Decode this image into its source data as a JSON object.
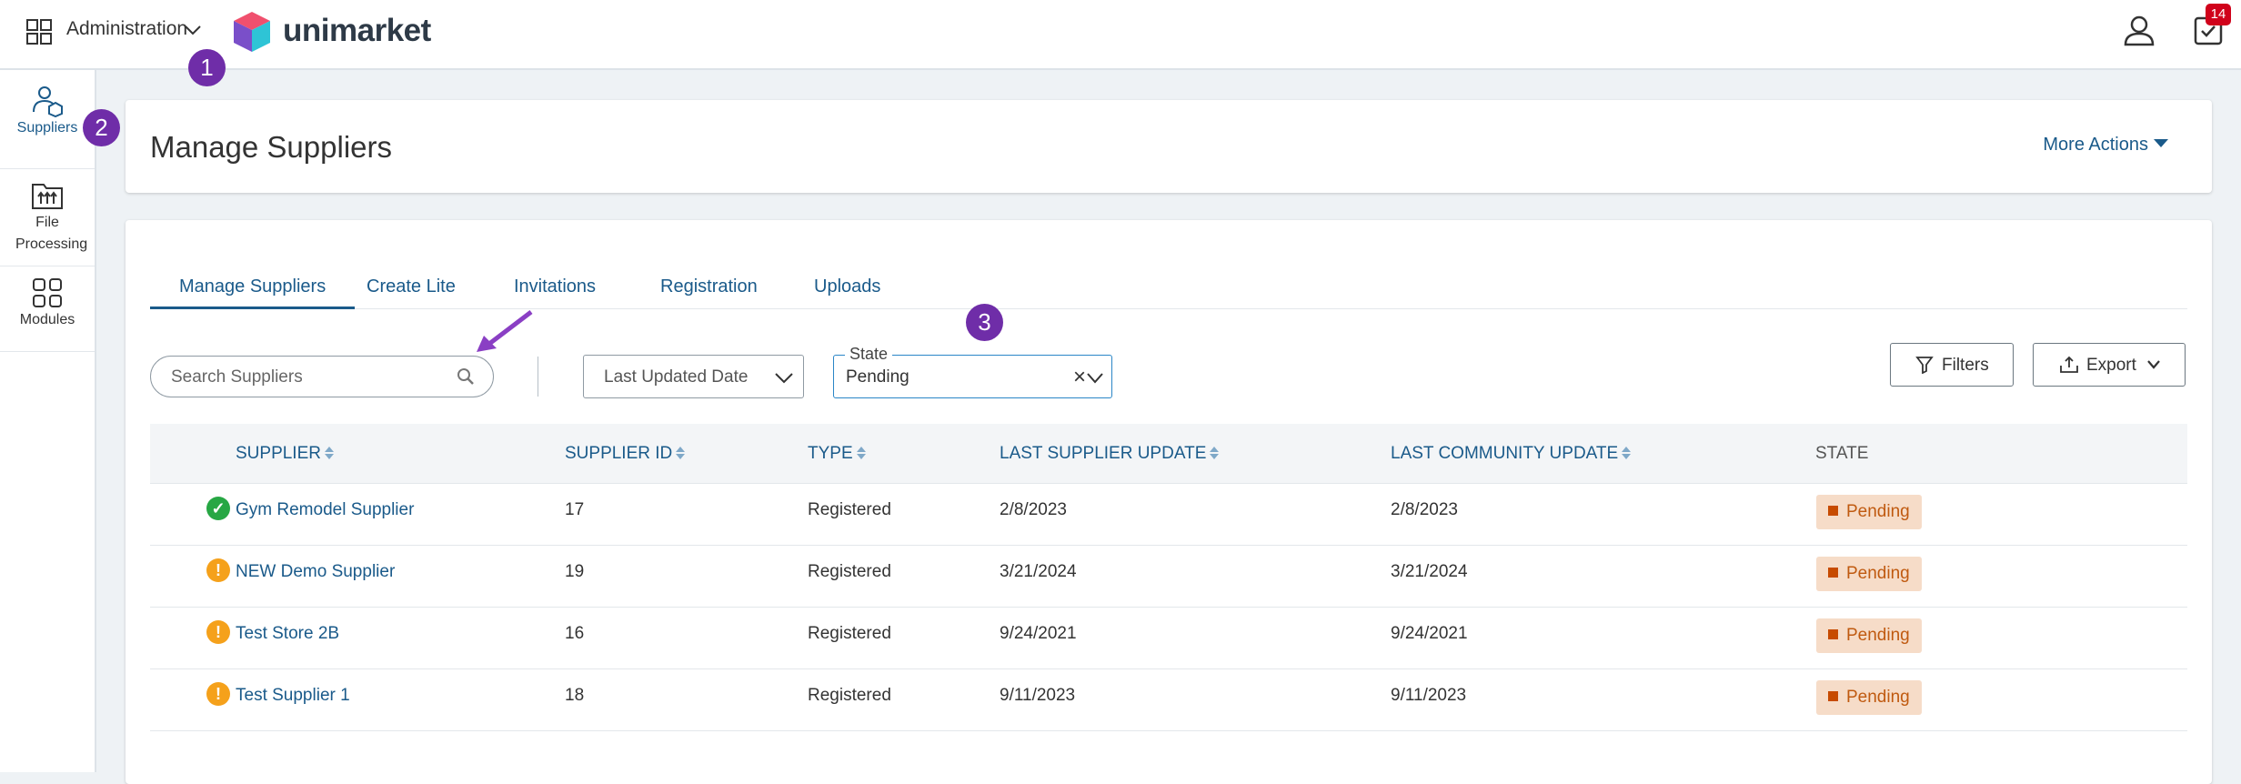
{
  "topbar": {
    "admin_label": "Administration",
    "brand": "unimarket",
    "tasks_badge": "14"
  },
  "annotations": [
    "1",
    "2",
    "3"
  ],
  "sidebar": {
    "items": [
      {
        "label": "Suppliers",
        "icon": "suppliers-icon",
        "active": true
      },
      {
        "label": "File Processing",
        "icon": "file-processing-icon",
        "active": false
      },
      {
        "label": "Modules",
        "icon": "modules-icon",
        "active": false
      }
    ]
  },
  "header": {
    "title": "Manage Suppliers",
    "more_actions": "More Actions"
  },
  "tabs": [
    {
      "label": "Manage Suppliers",
      "active": true
    },
    {
      "label": "Create Lite",
      "active": false
    },
    {
      "label": "Invitations",
      "active": false
    },
    {
      "label": "Registration",
      "active": false
    },
    {
      "label": "Uploads",
      "active": false
    }
  ],
  "toolbar": {
    "search_placeholder": "Search Suppliers",
    "date_filter": "Last Updated Date",
    "state_legend": "State",
    "state_value": "Pending",
    "filters_label": "Filters",
    "export_label": "Export"
  },
  "table": {
    "columns": [
      "SUPPLIER",
      "SUPPLIER ID",
      "TYPE",
      "LAST SUPPLIER UPDATE",
      "LAST COMMUNITY UPDATE",
      "STATE"
    ],
    "rows": [
      {
        "status": "ok",
        "supplier": "Gym Remodel Supplier",
        "id": "17",
        "type": "Registered",
        "supplier_update": "2/8/2023",
        "community_update": "2/8/2023",
        "state": "Pending"
      },
      {
        "status": "warn",
        "supplier": "NEW Demo Supplier",
        "id": "19",
        "type": "Registered",
        "supplier_update": "3/21/2024",
        "community_update": "3/21/2024",
        "state": "Pending"
      },
      {
        "status": "warn",
        "supplier": "Test Store 2B",
        "id": "16",
        "type": "Registered",
        "supplier_update": "9/24/2021",
        "community_update": "9/24/2021",
        "state": "Pending"
      },
      {
        "status": "warn",
        "supplier": "Test Supplier 1",
        "id": "18",
        "type": "Registered",
        "supplier_update": "9/11/2023",
        "community_update": "9/11/2023",
        "state": "Pending"
      }
    ]
  },
  "colors": {
    "accent": "#1a5a8a",
    "annotation": "#6f2da8",
    "pending_bg": "#f6dcc8",
    "pending_text": "#c05a10",
    "ok": "#27a744",
    "warn": "#f5a11b",
    "badge": "#d0021b"
  }
}
